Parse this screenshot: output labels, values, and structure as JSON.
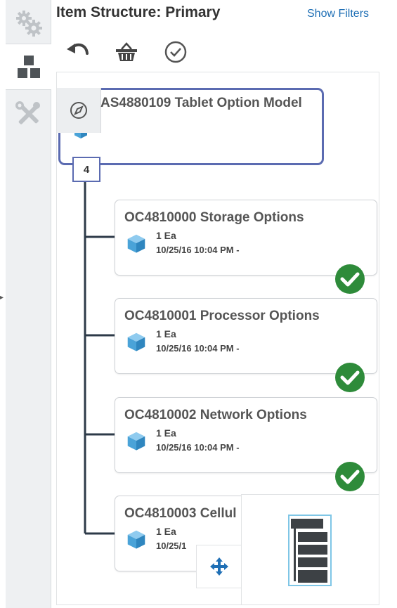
{
  "header": {
    "title": "Item Structure: Primary",
    "show_filters": "Show Filters"
  },
  "left_rail": {
    "tabs": [
      {
        "icon": "gears-icon"
      },
      {
        "icon": "hierarchy-icon"
      },
      {
        "icon": "tools-icon"
      }
    ]
  },
  "toolbar": {
    "buttons": [
      {
        "icon": "undo-icon"
      },
      {
        "icon": "basket-icon"
      },
      {
        "icon": "checkmark-circle-icon"
      }
    ]
  },
  "root_node": {
    "title": "AS4880109 Tablet Option Model",
    "child_count": "4"
  },
  "children": [
    {
      "title": "OC4810000 Storage Options",
      "qty": "1 Ea",
      "date": "10/25/16 10:04 PM -",
      "status": "valid"
    },
    {
      "title": "OC4810001 Processor Options",
      "qty": "1 Ea",
      "date": "10/25/16 10:04 PM -",
      "status": "valid"
    },
    {
      "title": "OC4810002 Network Options",
      "qty": "1 Ea",
      "date": "10/25/16 10:04 PM -",
      "status": "valid"
    },
    {
      "title": "OC4810003 Cellul",
      "qty": "1 Ea",
      "date": "10/25/1",
      "status": "none"
    }
  ],
  "colors": {
    "accent": "#5b6bb1",
    "link": "#1f6fb5",
    "success": "#2e8b3a",
    "cube": "#4aa3d8"
  }
}
